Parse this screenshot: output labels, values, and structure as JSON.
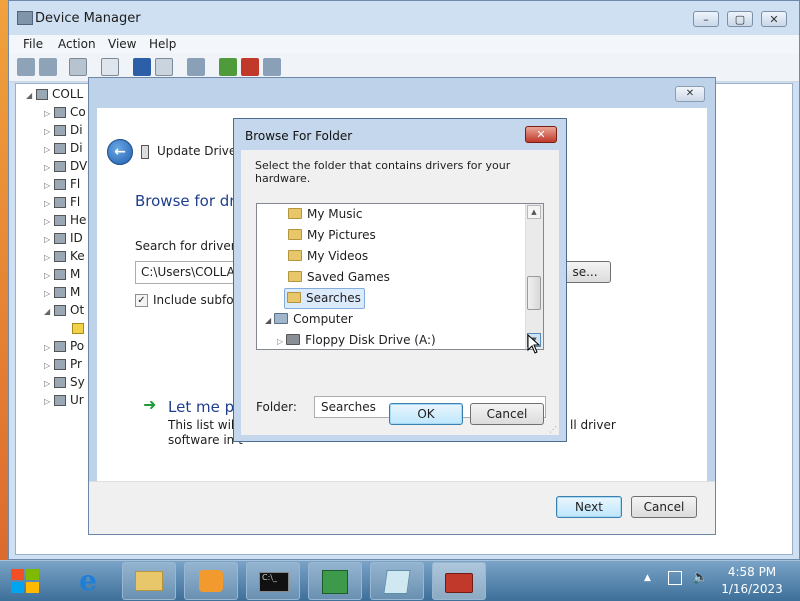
{
  "device_manager": {
    "title": "Device Manager",
    "menu": [
      "File",
      "Action",
      "View",
      "Help"
    ],
    "tree": {
      "root": "COLL",
      "items": [
        "Co",
        "Di",
        "Di",
        "DV",
        "Fl",
        "Fl",
        "He",
        "ID",
        "Ke",
        "M",
        "M",
        "Ot",
        "",
        "Po",
        "Pr",
        "Sy",
        "Ur"
      ]
    }
  },
  "wizard": {
    "title": "Update Driver S",
    "heading": "Browse for dri",
    "search_label": "Search for driver so",
    "path_value": "C:\\Users\\COLLAB",
    "browse_label": "se...",
    "include_label": "Include subfold",
    "letme_title": "Let me pi",
    "letme_desc1": "This list will s",
    "letme_desc1_tail": "ll driver",
    "letme_desc2": "software in t",
    "next_label": "Next",
    "cancel_label": "Cancel"
  },
  "browse_dialog": {
    "title": "Browse For Folder",
    "close_glyph": "✕",
    "instruction": "Select the folder that contains drivers for your hardware.",
    "folders": [
      {
        "label": "My Music",
        "icon": "music-folder-icon"
      },
      {
        "label": "My Pictures",
        "icon": "pictures-folder-icon"
      },
      {
        "label": "My Videos",
        "icon": "videos-folder-icon"
      },
      {
        "label": "Saved Games",
        "icon": "games-folder-icon"
      },
      {
        "label": "Searches",
        "icon": "search-folder-icon",
        "selected": true
      },
      {
        "label": "Computer",
        "icon": "computer-icon"
      },
      {
        "label": "Floppy Disk Drive (A:)",
        "icon": "floppy-icon"
      }
    ],
    "folder_label": "Folder:",
    "folder_value": "Searches",
    "ok_label": "OK",
    "cancel_label": "Cancel"
  },
  "taskbar": {
    "time": "4:58 PM",
    "date": "1/16/2023"
  },
  "colors": {
    "selection": "#dcebfc",
    "default_button": "#bee6fd",
    "close_button": "#c0392b"
  }
}
